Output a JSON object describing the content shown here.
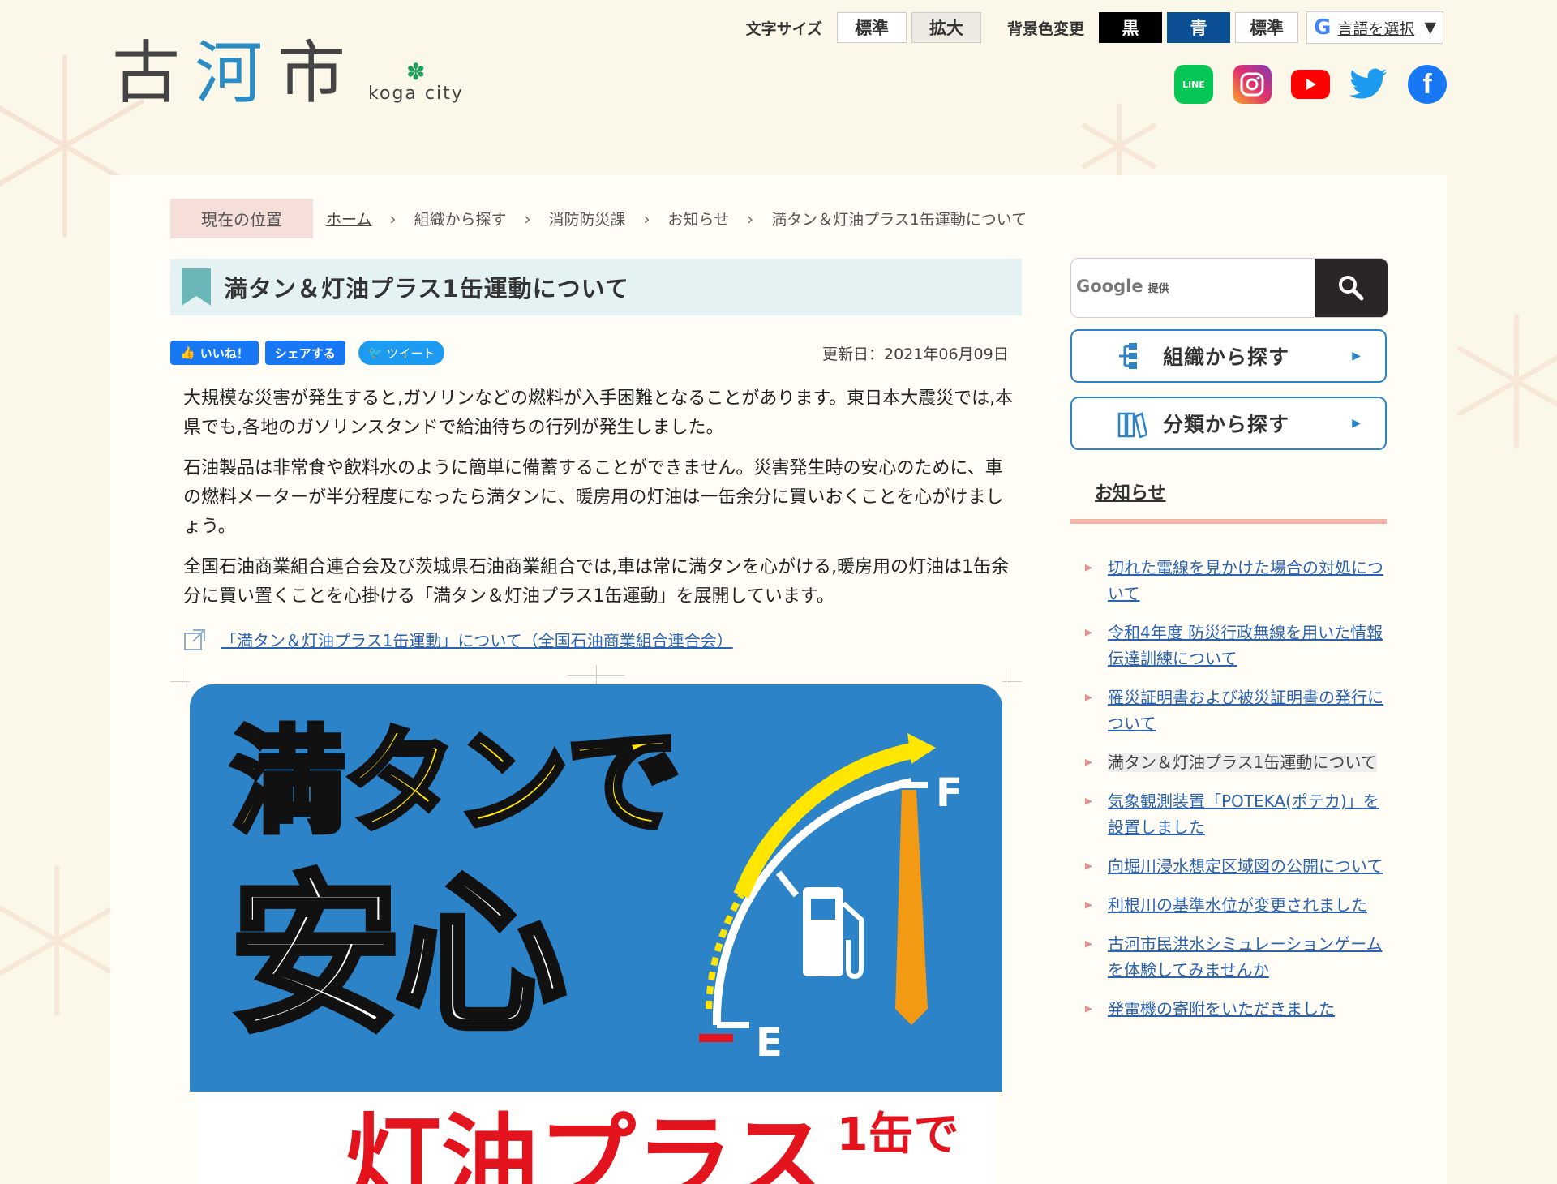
{
  "header": {
    "logo_kanji_1": "古",
    "logo_kanji_2": "河",
    "logo_kanji_3": "市",
    "logo_roman": "koga city",
    "font_size_label": "文字サイズ",
    "font_standard": "標準",
    "font_large": "拡大",
    "bg_label": "背景色変更",
    "bg_black": "黒",
    "bg_blue": "青",
    "bg_standard": "標準",
    "lang_label": "言語を選択",
    "lang_arrow": "▼"
  },
  "social": [
    "LINE",
    "Instagram",
    "YouTube",
    "Twitter",
    "Facebook"
  ],
  "breadcrumb": {
    "here": "現在の位置",
    "items": [
      "ホーム",
      "組織から探す",
      "消防防災課",
      "お知らせ",
      "満タン＆灯油プラス1缶運動について"
    ]
  },
  "article": {
    "title": "満タン＆灯油プラス1缶運動について",
    "like": "いいね！",
    "share": "シェアする",
    "tweet": "ツイート",
    "updated": "更新日：2021年06月09日",
    "paragraphs": [
      "大規模な災害が発生すると,ガソリンなどの燃料が入手困難となることがあります。東日本大震災では,本県でも,各地のガソリンスタンドで給油待ちの行列が発生しました。",
      "石油製品は非常食や飲料水のように簡単に備蓄することができません。災害発生時の安心のために、車の燃料メーターが半分程度になったら満タンに、暖房用の灯油は一缶余分に買いおくことを心がけましょう。",
      "全国石油商業組合連合会及び茨城県石油商業組合では,車は常に満タンを心がける,暖房用の灯油は1缶余分に買い置くことを心掛ける「満タン＆灯油プラス1缶運動」を展開しています。"
    ],
    "external_link": "「満タン＆灯油プラス1缶運動」について（全国石油商業組合連合会）"
  },
  "poster": {
    "line1": "満タンで",
    "line2": "安心",
    "line3": "灯油プラス",
    "line3_small": "1缶で",
    "gauge_f": "F",
    "gauge_e": "E"
  },
  "sidebar": {
    "search_brand": "Google",
    "search_provided": "提供",
    "nav_org": "組織から探す",
    "nav_cat": "分類から探す",
    "news_title": "お知らせ",
    "news": [
      "切れた電線を見かけた場合の対処について",
      "令和4年度 防災行政無線を用いた情報伝達訓練について",
      "罹災証明書および被災証明書の発行について",
      "満タン＆灯油プラス1缶運動について",
      "気象観測装置「POTEKA(ポテカ)」を設置しました",
      "向堀川浸水想定区域図の公開について",
      "利根川の基準水位が変更されました",
      "古河市民洪水シミュレーションゲームを体験してみませんか",
      "発電機の寄附をいただきました"
    ]
  },
  "colors": {
    "accent_blue": "#2c83c8",
    "poster_yellow": "#ffe600",
    "poster_red": "#e4141e",
    "breadcrumb_bg": "#f6dfd8"
  }
}
